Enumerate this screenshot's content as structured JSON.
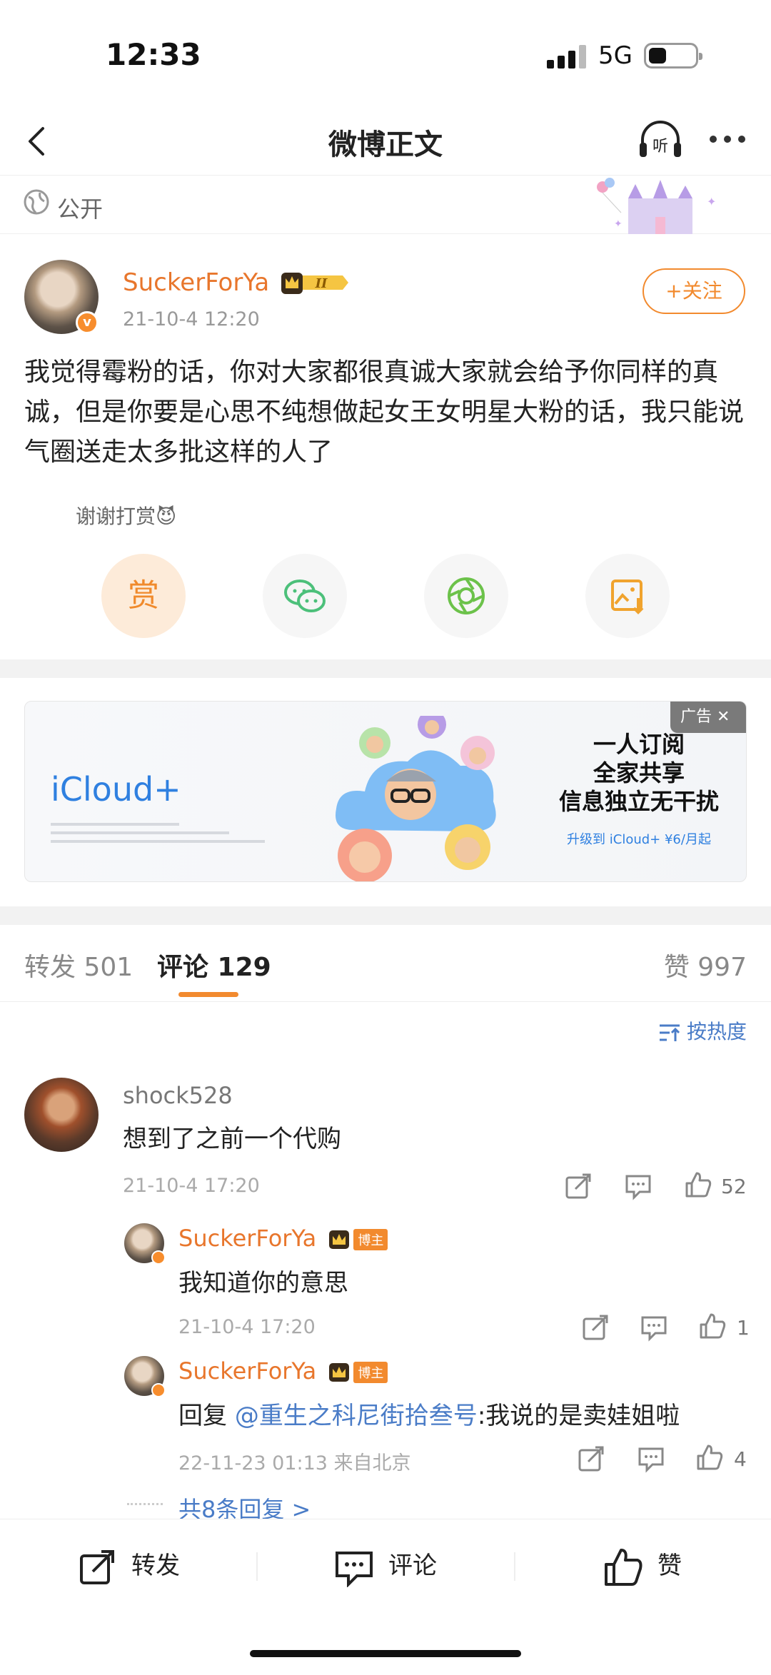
{
  "status_bar": {
    "time": "12:33",
    "network": "5G"
  },
  "nav": {
    "title": "微博正文",
    "listen_label": "听"
  },
  "post": {
    "visibility": "公开",
    "author": "SuckerForYa",
    "vip_level": "II",
    "time": "21-10-4 12:20",
    "follow_label": "+关注",
    "content": "我觉得霉粉的话，你对大家都很真诚大家就会给予你同样的真诚，但是你要是心思不纯想做起女王女明星大粉的话，我只能说气圈送走太多批这样的人了",
    "thanks_label": "谢谢打赏😈",
    "reward_label": "赏"
  },
  "ad": {
    "brand": "iCloud+",
    "line1": "一人订阅",
    "line2": "全家共享",
    "line3": "信息独立无干扰",
    "sub": "升级到 iCloud+ ¥6/月起",
    "tag": "广告 ✕"
  },
  "tabs": {
    "repost": "转发 501",
    "comment": "评论 129",
    "like": "赞 997"
  },
  "sort_label": "按热度",
  "comments": [
    {
      "user": "shock528",
      "text": "想到了之前一个代购",
      "time": "21-10-4 17:20",
      "likes": "52"
    }
  ],
  "replies": [
    {
      "user": "SuckerForYa",
      "badge": "博主",
      "text": "我知道你的意思",
      "time": "21-10-4 17:20",
      "likes": "1"
    },
    {
      "user": "SuckerForYa",
      "badge": "博主",
      "prefix": "回复 ",
      "mention": "@重生之科尼街拾叁号",
      "text": ":我说的是卖娃姐啦",
      "time": "22-11-23 01:13 来自北京",
      "likes": "4"
    }
  ],
  "more_replies": "共8条回复 >",
  "bottom": {
    "repost": "转发",
    "comment": "评论",
    "like": "赞"
  },
  "colors": {
    "accent": "#f28a2e",
    "username": "#e8762c",
    "link": "#4a7cc7"
  }
}
